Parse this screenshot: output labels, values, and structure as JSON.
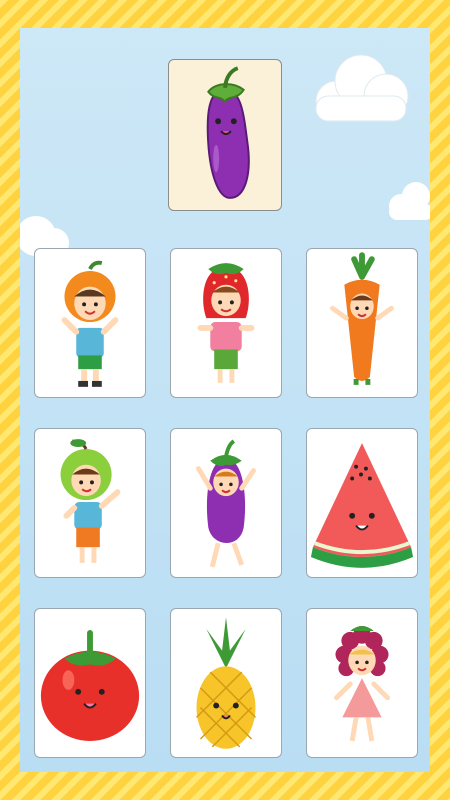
{
  "game": {
    "target_icon": "eggplant-icon",
    "cards": [
      {
        "icon": "orange-kid-icon"
      },
      {
        "icon": "strawberry-kid-icon"
      },
      {
        "icon": "carrot-kid-icon"
      },
      {
        "icon": "apple-kid-icon"
      },
      {
        "icon": "eggplant-kid-icon"
      },
      {
        "icon": "watermelon-icon"
      },
      {
        "icon": "tomato-icon"
      },
      {
        "icon": "pineapple-icon"
      },
      {
        "icon": "raspberry-kid-icon"
      }
    ]
  },
  "colors": {
    "frame": "#ffd23f",
    "board": "#c4e3f5",
    "target_card": "#fbf1d9"
  }
}
